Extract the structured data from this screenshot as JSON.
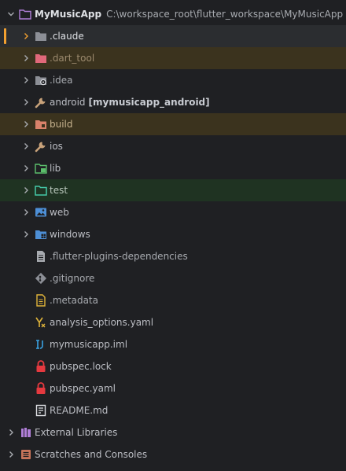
{
  "project": {
    "name": "MyMusicApp",
    "path": "C:\\workspace_root\\flutter_workspace\\MyMusicApp"
  },
  "folders": {
    "claude": ".claude",
    "dart_tool": ".dart_tool",
    "idea": ".idea",
    "android": "android",
    "android_module": "[mymusicapp_android]",
    "build": "build",
    "ios": "ios",
    "lib": "lib",
    "test": "test",
    "web": "web",
    "windows": "windows"
  },
  "files": {
    "flutter_plugins": ".flutter-plugins-dependencies",
    "gitignore": ".gitignore",
    "metadata": ".metadata",
    "analysis_options": "analysis_options.yaml",
    "iml": "mymusicapp.iml",
    "pubspec_lock": "pubspec.lock",
    "pubspec_yaml": "pubspec.yaml",
    "readme": "README.md"
  },
  "roots": {
    "external_libraries": "External Libraries",
    "scratches": "Scratches and Consoles"
  },
  "icons": {
    "folder": "folder-icon",
    "module": "module-icon",
    "wrench": "wrench-icon",
    "lock": "lock-icon",
    "file": "file-icon"
  },
  "colors": {
    "background": "#1f2023",
    "selection": "#2b2d30",
    "excluded_row": "#3b331e",
    "test_row": "#1f3322",
    "excluded_folder": "#e0687a",
    "source_folder": "#5cbf6c",
    "test_folder": "#45c9a8",
    "lock": "#e5393f",
    "focus_marker": "#f2a030"
  }
}
